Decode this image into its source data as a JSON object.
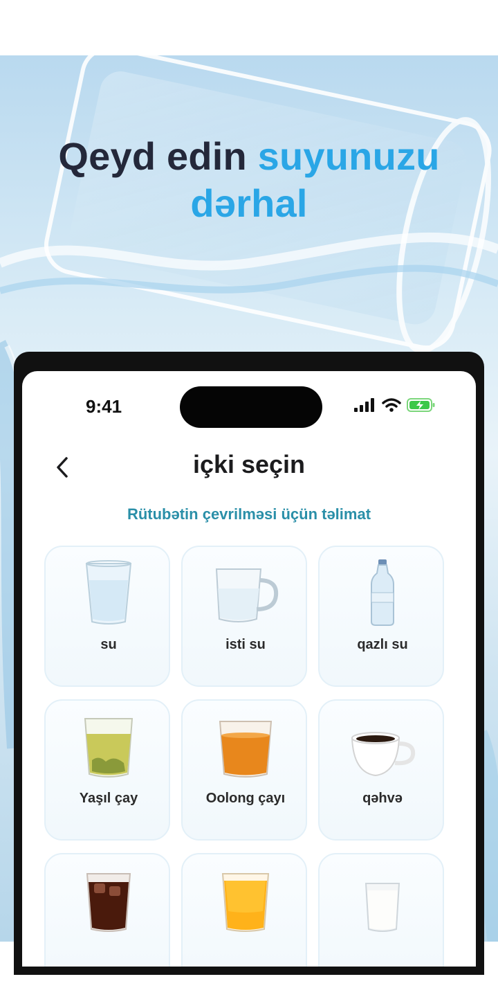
{
  "promo": {
    "headline_part1": "Qeyd edin ",
    "headline_accent1": "suyunuzu",
    "headline_accent2": "dərhal",
    "accent_color": "#2aa6e6"
  },
  "status_bar": {
    "time": "9:41",
    "icons": [
      "signal-icon",
      "wifi-icon",
      "battery-charging-icon"
    ]
  },
  "header": {
    "back_icon": "chevron-left-icon",
    "title": "içki seçin",
    "subtitle": "Rütubətin çevrilməsi üçün təlimat"
  },
  "drinks": [
    {
      "label": "su",
      "icon": "water-glass-icon"
    },
    {
      "label": "isti su",
      "icon": "glass-mug-icon"
    },
    {
      "label": "qazlı su",
      "icon": "water-bottle-icon"
    },
    {
      "label": "Yaşıl çay",
      "icon": "green-tea-glass-icon"
    },
    {
      "label": "Oolong çayı",
      "icon": "oolong-tea-glass-icon"
    },
    {
      "label": "qəhvə",
      "icon": "coffee-cup-icon"
    },
    {
      "label": "",
      "icon": "cola-glass-icon"
    },
    {
      "label": "",
      "icon": "orange-juice-glass-icon"
    },
    {
      "label": "",
      "icon": "milk-glass-icon"
    }
  ]
}
